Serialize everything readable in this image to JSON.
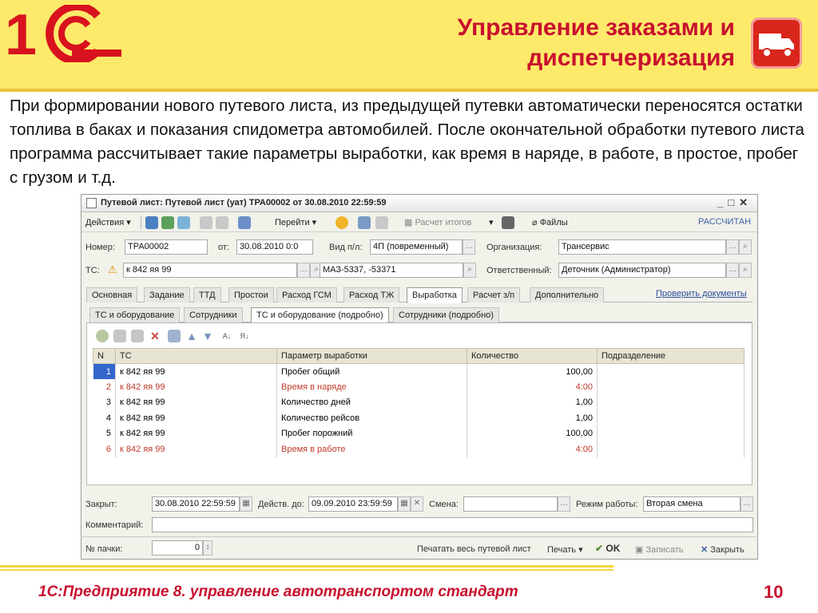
{
  "header": {
    "logo": "1С",
    "title_line1": "Управление заказами и",
    "title_line2": "диспетчеризация"
  },
  "intro": "При формировании нового путевого листа, из предыдущей путевки автоматически переносятся остатки топлива в баках и показания спидометра автомобилей. После окончательной обработки путевого листа программа рассчитывает такие параметры выработки, как время в наряде, в работе, в простое, пробег с грузом и т.д.",
  "window": {
    "title": "Путевой лист: Путевой лист (уат) ТРА00002 от 30.08.2010 22:59:59",
    "toolbar": {
      "actions": "Действия",
      "goto": "Перейти",
      "calc_totals": "Расчет итогов",
      "files": "Файлы",
      "status": "РАССЧИТАН"
    },
    "form": {
      "number_label": "Номер:",
      "number": "ТРА00002",
      "from_label": "от:",
      "date": "30.08.2010 0:0",
      "type_label": "Вид п/л:",
      "type": "4П (повременный)",
      "org_label": "Организация:",
      "org": "Трансервис",
      "vehicle_label": "ТС:",
      "vehicle": "к 842 яя 99",
      "model": "МАЗ-5337, -53371",
      "resp_label": "Ответственный:",
      "resp": "Деточник (Администратор)"
    },
    "tabs": [
      "Основная",
      "Задание",
      "ТТД",
      "Простои",
      "Расход ГСМ",
      "Расход ТЖ",
      "Выработка",
      "Расчет з/п",
      "Дополнительно"
    ],
    "check_docs": "Проверить документы",
    "subtabs": [
      "ТС и оборудование",
      "Сотрудники",
      "ТС и оборудование (подробно)",
      "Сотрудники (подробно)"
    ],
    "table": {
      "headers": [
        "N",
        "ТС",
        "Параметр выработки",
        "Количество",
        "Подразделение"
      ],
      "rows": [
        {
          "n": "1",
          "ts": "к 842 яя 99",
          "param": "Пробег общий",
          "qty": "100,00",
          "dept": ""
        },
        {
          "n": "2",
          "ts": "к 842 яя 99",
          "param": "Время в наряде",
          "qty": "4:00",
          "dept": ""
        },
        {
          "n": "3",
          "ts": "к 842 яя 99",
          "param": "Количество дней",
          "qty": "1,00",
          "dept": ""
        },
        {
          "n": "4",
          "ts": "к 842 яя 99",
          "param": "Количество рейсов",
          "qty": "1,00",
          "dept": ""
        },
        {
          "n": "5",
          "ts": "к 842 яя 99",
          "param": "Пробег порожний",
          "qty": "100,00",
          "dept": ""
        },
        {
          "n": "6",
          "ts": "к 842 яя 99",
          "param": "Время в работе",
          "qty": "4:00",
          "dept": ""
        }
      ]
    },
    "bottom": {
      "closed_label": "Закрыт:",
      "closed": "30.08.2010 22:59:59",
      "valid_label": "Действ. до:",
      "valid": "09.09.2010 23:59:59",
      "shift_label": "Смена:",
      "mode_label": "Режим работы:",
      "mode": "Вторая смена",
      "comment_label": "Комментарий:",
      "pack_label": "№ пачки:",
      "pack": "0",
      "print_all": "Печатать весь путевой лист",
      "print": "Печать",
      "ok": "OK",
      "save": "Записать",
      "close": "Закрыть"
    }
  },
  "footer": {
    "text": "1С:Предприятие 8. управление автотранспортом стандарт",
    "page": "10"
  },
  "colors": {
    "accent": "#c8102e",
    "header_bg": "#fde96a",
    "selection": "#3366cc"
  }
}
